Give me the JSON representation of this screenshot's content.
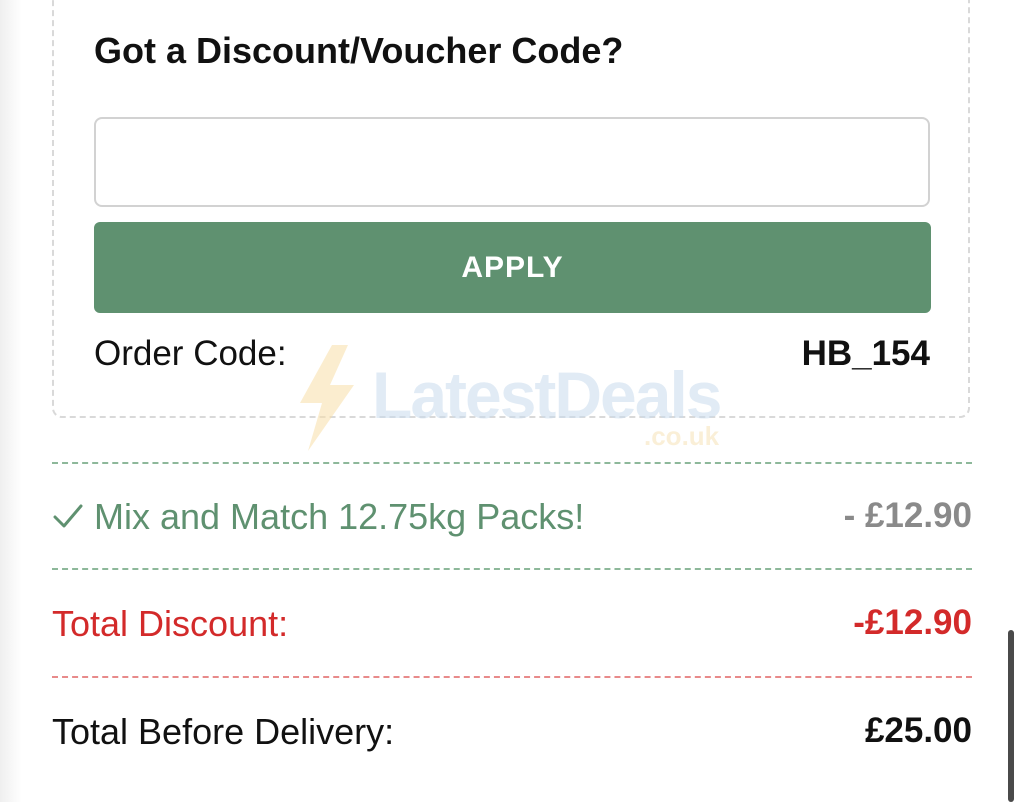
{
  "voucher": {
    "title": "Got a Discount/Voucher Code?",
    "input_value": "",
    "apply_label": "APPLY",
    "order_code_label": "Order Code:",
    "order_code_value": "HB_154"
  },
  "watermark": {
    "brand": "LatestDeals",
    "suffix": ".co.uk",
    "icon": "lightning-bolt-icon"
  },
  "promotions": [
    {
      "icon": "checkmark-icon",
      "label": "Mix and Match 12.75kg Packs!",
      "value": "- £12.90"
    }
  ],
  "summary": {
    "total_discount_label": "Total Discount:",
    "total_discount_value": "-£12.90",
    "total_before_delivery_label": "Total Before Delivery:",
    "total_before_delivery_value": "£25.00"
  },
  "colors": {
    "accent_green": "#5f9170",
    "discount_red": "#d32a2a",
    "muted_grey": "#8a8a8a"
  }
}
